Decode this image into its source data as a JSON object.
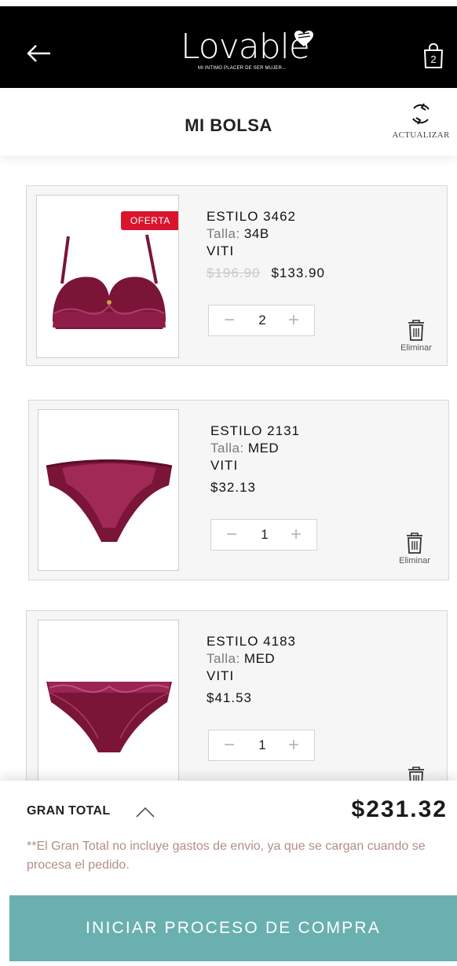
{
  "topbar": {
    "logo_text": "Lovable",
    "logo_tagline": "MI INTIMO PLACER DE SER MUJER...",
    "bag_count": "2"
  },
  "header": {
    "title": "MI BOLSA",
    "refresh_label": "ACTUALIZAR"
  },
  "items": [
    {
      "badge": "OFERTA",
      "style": "ESTILO 3462",
      "size_label": "Talla:",
      "size_value": "34B",
      "color": "VITI",
      "old_price": "$196.90",
      "price": "$133.90",
      "quantity": "2",
      "minus": "−",
      "plus": "+",
      "delete_label": "Eliminar"
    },
    {
      "style": "ESTILO 2131",
      "size_label": "Talla:",
      "size_value": "MED",
      "color": "VITI",
      "price": "$32.13",
      "quantity": "1",
      "minus": "−",
      "plus": "+",
      "delete_label": "Eliminar"
    },
    {
      "style": "ESTILO 4183",
      "size_label": "Talla:",
      "size_value": "MED",
      "color": "VITI",
      "price": "$41.53",
      "quantity": "1",
      "minus": "−",
      "plus": "+"
    }
  ],
  "footer": {
    "total_label": "GRAN TOTAL",
    "total_value": "$231.32",
    "note": "**El Gran Total no incluye gastos de envio, ya que se cargan cuando se procesa el pedido.",
    "checkout_label": "INICIAR PROCESO DE COMPRA"
  },
  "colors": {
    "topbar": "#000000",
    "offer_badge": "#d9142c",
    "product": "#7a1538",
    "checkout": "#6ab0b0",
    "note": "#b38d86"
  },
  "icons": [
    "back-arrow-icon",
    "heart-icon",
    "shopping-bag-icon",
    "refresh-icon",
    "trash-icon",
    "chevron-up-icon"
  ]
}
